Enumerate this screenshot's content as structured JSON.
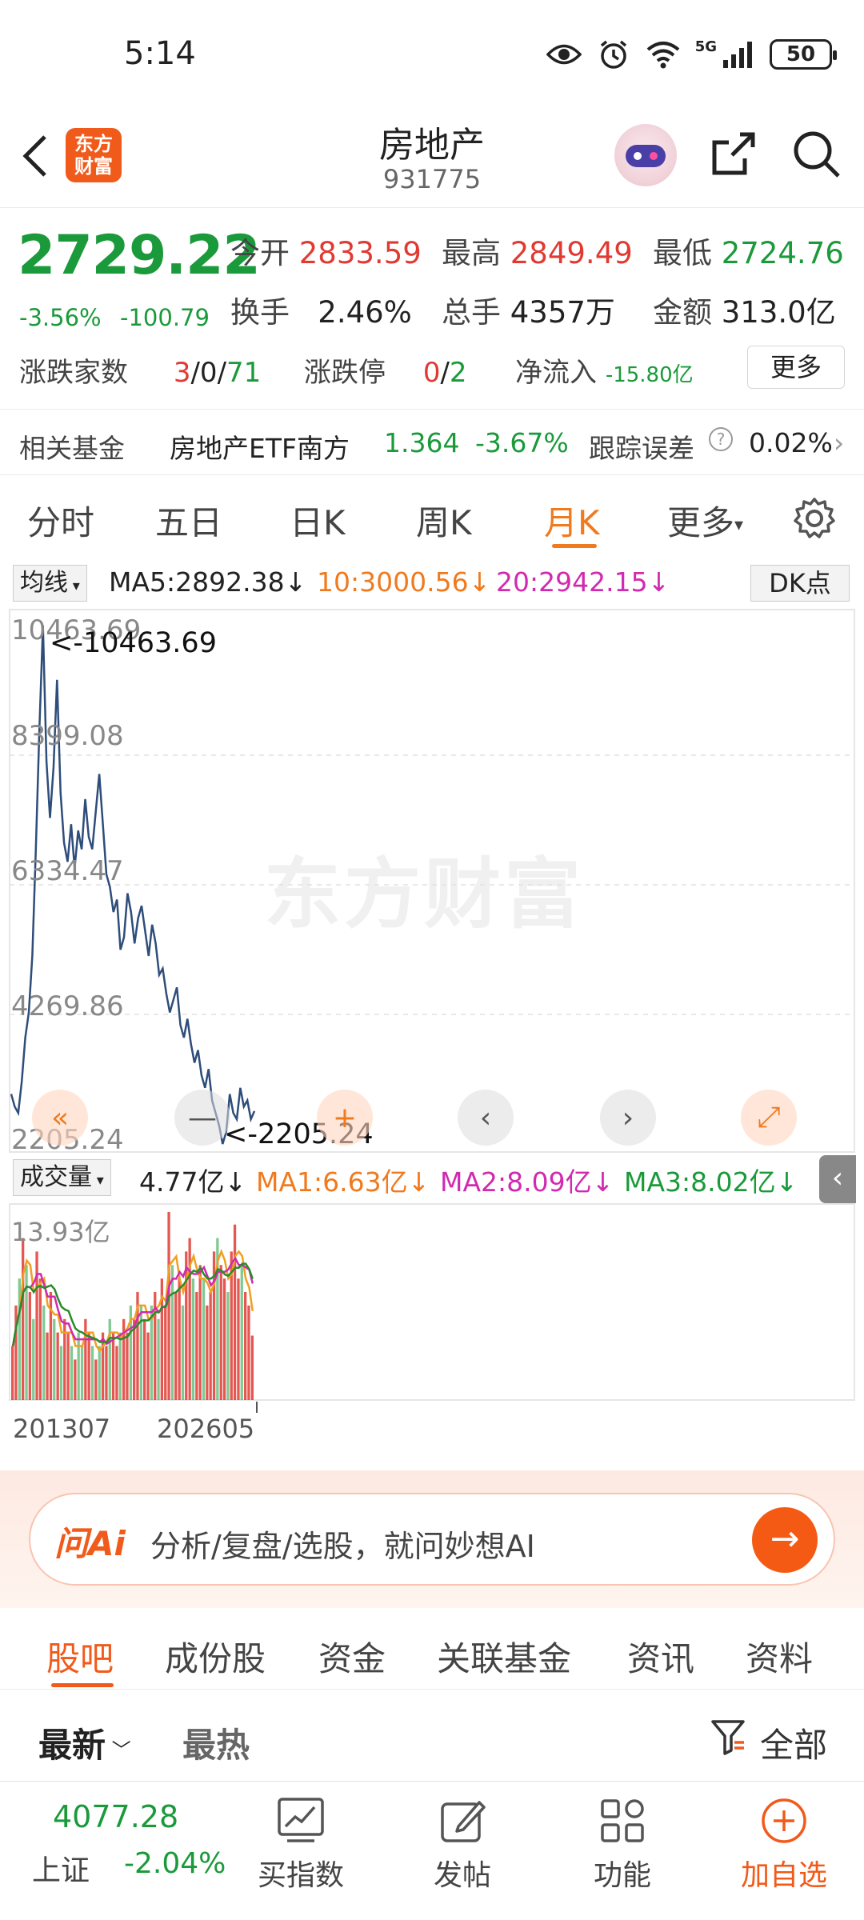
{
  "status_bar": {
    "time": "5:14",
    "network": "5G",
    "battery": "50"
  },
  "header": {
    "logo_text": "东方财富",
    "title": "房地产",
    "code": "931775"
  },
  "quote": {
    "price": "2729.22",
    "change_pct": "-3.56%",
    "change_abs": "-100.79",
    "open_label": "今开",
    "open": "2833.59",
    "high_label": "最高",
    "high": "2849.49",
    "low_label": "最低",
    "low": "2724.76",
    "turnover_label": "换手",
    "turnover": "2.46%",
    "volume_label": "总手",
    "volume": "4357万",
    "amount_label": "金额",
    "amount": "313.0亿",
    "breadth_label": "涨跌家数",
    "breadth_up": "3",
    "breadth_flat": "0",
    "breadth_down": "71",
    "sep": "/",
    "limit_label": "涨跌停",
    "limit_up": "0",
    "limit_down": "2",
    "inflow_label": "净流入",
    "inflow": "-15.80亿",
    "more": "更多"
  },
  "fund": {
    "label": "相关基金",
    "name": "房地产ETF南方",
    "price": "1.364",
    "pct": "-3.67%",
    "err_label": "跟踪误差",
    "err_value": "0.02%"
  },
  "period_tabs": [
    "分时",
    "五日",
    "日K",
    "周K",
    "月K",
    "更多"
  ],
  "active_tab": "月K",
  "ma": {
    "selector": "均线",
    "ma5": "MA5:2892.38",
    "ma10": "10:3000.56",
    "ma20": "20:2942.15",
    "dk": "DK点"
  },
  "price_axis": [
    "10463.69",
    "8399.08",
    "6334.47",
    "4269.86",
    "2205.24"
  ],
  "extremes": {
    "high": "<-10463.69",
    "low": "<-2205.24"
  },
  "watermark": "东方财富",
  "volume": {
    "selector": "成交量",
    "current": "4.77亿",
    "ma1": "MA1:6.63亿",
    "ma2": "MA2:8.09亿",
    "ma3": "MA3:8.02亿",
    "max_label": "13.93亿"
  },
  "x_labels": [
    "201307",
    "202605"
  ],
  "colors": {
    "down": "#1a9a3a",
    "up": "#e03a33",
    "accent": "#f07a1e",
    "line": "#2e4d7a",
    "ma_orange": "#f0a020",
    "ma_magenta": "#d12ab0",
    "ma_green": "#2a8a2a"
  },
  "chart_data": {
    "type": "line",
    "title": "",
    "ylim": [
      2205.24,
      10463.69
    ],
    "y_ticks": [
      10463.69,
      8399.08,
      6334.47,
      4269.86,
      2205.24
    ],
    "x_range": [
      "201307",
      "202605"
    ],
    "values": [
      3000,
      2800,
      2700,
      3200,
      3900,
      4300,
      5200,
      6900,
      8800,
      10463.69,
      8300,
      7400,
      8200,
      9600,
      7800,
      7000,
      6700,
      7300,
      6600,
      7200,
      6900,
      7700,
      7100,
      6900,
      7500,
      8100,
      7300,
      6500,
      6300,
      5900,
      6100,
      5300,
      5500,
      6200,
      5900,
      5400,
      5800,
      6000,
      5600,
      5200,
      5700,
      5400,
      4900,
      5000,
      4600,
      4300,
      4500,
      4700,
      4100,
      3900,
      4200,
      3800,
      3500,
      3700,
      3300,
      3100,
      3400,
      2900,
      2700,
      2500,
      2205.24,
      2400,
      3000,
      2700,
      2600,
      3100,
      2800,
      2900,
      2600,
      2729.22
    ],
    "volume": {
      "ylim": [
        0,
        13.93
      ],
      "bars": [
        4,
        7,
        9,
        12,
        10,
        8,
        6,
        11,
        9,
        7,
        5,
        8,
        6,
        5,
        4,
        6,
        5,
        4,
        3,
        5,
        4,
        6,
        5,
        4,
        3,
        4,
        5,
        4,
        6,
        5,
        4,
        5,
        6,
        5,
        7,
        6,
        8,
        7,
        6,
        5,
        7,
        8,
        6,
        9,
        7,
        13.93,
        10,
        8,
        9,
        7,
        11,
        12,
        9,
        8,
        10,
        9,
        7,
        8,
        11,
        12,
        10,
        9,
        8,
        11,
        13,
        9,
        10,
        8,
        7,
        4.77
      ],
      "bar_up": [
        true,
        true,
        false,
        true,
        false,
        true,
        false,
        true,
        true,
        false,
        true,
        true,
        false,
        true,
        false,
        true,
        true,
        false,
        true,
        false,
        false,
        true,
        true,
        false,
        true,
        false,
        true,
        true,
        false,
        true,
        true,
        false,
        true,
        true,
        false,
        true,
        true,
        false,
        true,
        true,
        false,
        true,
        false,
        true,
        true,
        true,
        false,
        true,
        true,
        false,
        true,
        true,
        false,
        true,
        true,
        false,
        true,
        true,
        true,
        false,
        true,
        true,
        false,
        true,
        true,
        true,
        false,
        true,
        true,
        true
      ]
    }
  },
  "ai": {
    "logo": "问Ai",
    "prompt": "分析/复盘/选股，就问妙想AI"
  },
  "content_tabs": [
    "股吧",
    "成份股",
    "资金",
    "关联基金",
    "资讯",
    "资料"
  ],
  "filters": {
    "latest": "最新",
    "hot": "最热",
    "all": "全部"
  },
  "bottom": {
    "index_value": "4077.28",
    "index_name": "上证",
    "index_pct": "-2.04%",
    "buy_index": "买指数",
    "post": "发帖",
    "functions": "功能",
    "add": "加自选"
  }
}
